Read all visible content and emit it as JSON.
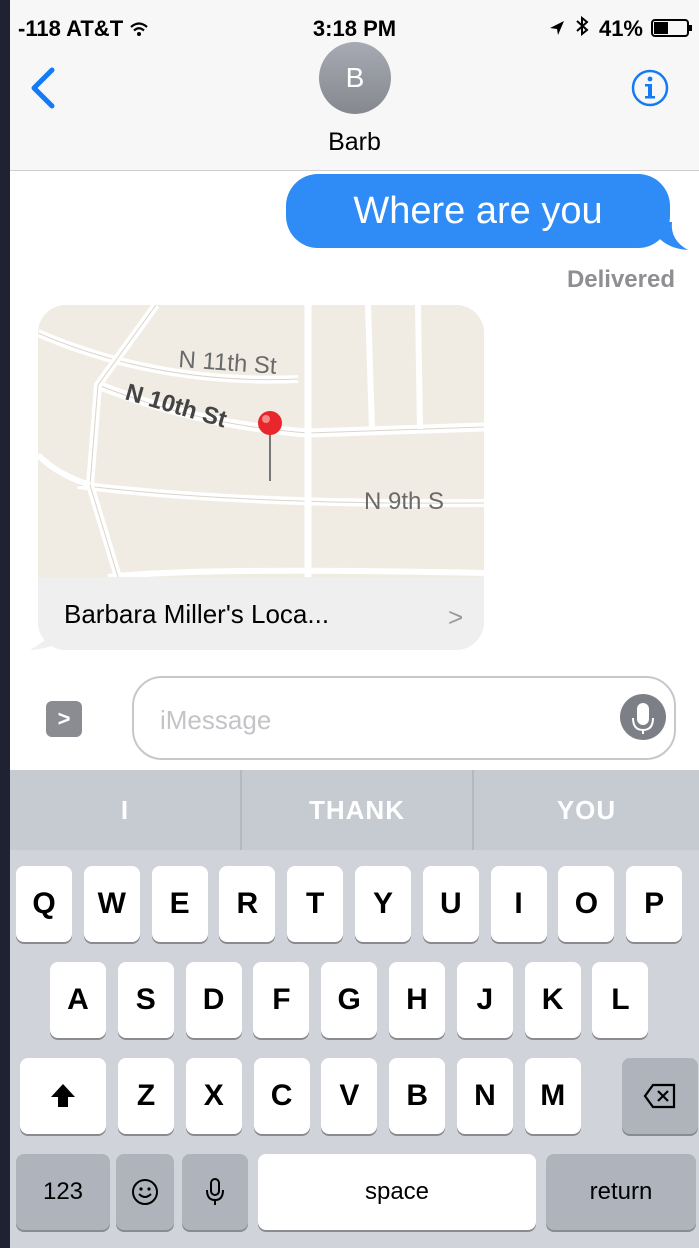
{
  "status_bar": {
    "carrier": "-118 AT&T",
    "time": "3:18 PM",
    "battery": "41%"
  },
  "header": {
    "avatar_initial": "B",
    "contact_name": "Barb"
  },
  "conversation": {
    "sent_message": "Where are you",
    "delivery_status": "Delivered",
    "location_card": {
      "streets": [
        "N 11th St",
        "N 10th St",
        "N 9th S"
      ],
      "label": "Barbara Miller's Loca...",
      "chevron": ">"
    }
  },
  "input": {
    "apps_chevron": ">",
    "placeholder": "iMessage"
  },
  "keyboard": {
    "predictions": [
      "I",
      "THANK",
      "YOU"
    ],
    "row1": [
      "Q",
      "W",
      "E",
      "R",
      "T",
      "Y",
      "U",
      "I",
      "O",
      "P"
    ],
    "row2": [
      "A",
      "S",
      "D",
      "F",
      "G",
      "H",
      "J",
      "K",
      "L"
    ],
    "row3": [
      "Z",
      "X",
      "C",
      "V",
      "B",
      "N",
      "M"
    ],
    "numbers_key": "123",
    "space_key": "space",
    "return_key": "return"
  },
  "colors": {
    "accent_blue": "#2f8cf6",
    "link_blue": "#137bf5",
    "pin_red": "#e8262b"
  }
}
